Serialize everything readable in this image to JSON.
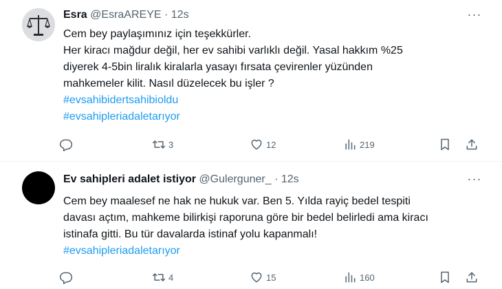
{
  "tweets": [
    {
      "name": "Esra",
      "handle": "@EsraAREYE",
      "separator": "·",
      "time": "12s",
      "more": "···",
      "lines": [
        "Cem bey paylaşımınız için teşekkürler.",
        "Her kiracı mağdur değil, her ev sahibi varlıklı değil. Yasal hakkım %25",
        "diyerek 4-5bin liralık kiralarla yasayı fırsata çevirenler yüzünden",
        "mahkemeler kilit. Nasıl düzelecek bu işler ?"
      ],
      "hashtags": [
        "#evsahibidertsahibioldu",
        "#evsahipleriadaletarıyor"
      ],
      "reply_count": "",
      "retweet_count": "3",
      "like_count": "12",
      "view_count": "219"
    },
    {
      "name": "Ev sahipleri adalet istiyor",
      "handle": "@Gulerguner_",
      "separator": "·",
      "time": "12s",
      "more": "···",
      "lines": [
        "Cem bey maalesef ne hak ne hukuk var. Ben 5. Yılda rayiç bedel tespiti",
        "davası açtım, mahkeme bilirkişi raporuna göre bir bedel belirledi ama kiracı",
        "istinafa gitti. Bu tür davalarda istinaf yolu kapanmalı!"
      ],
      "hashtags": [
        "#evsahipleriadaletarıyor"
      ],
      "reply_count": "",
      "retweet_count": "4",
      "like_count": "15",
      "view_count": "160"
    }
  ],
  "icons": {
    "reply": "reply-icon",
    "retweet": "retweet-icon",
    "like": "heart-icon",
    "views": "views-icon",
    "bookmark": "bookmark-icon",
    "share": "share-icon"
  },
  "colors": {
    "text": "#0f1419",
    "secondary": "#536471",
    "link": "#1d9bf0",
    "border": "#eff3f4"
  }
}
